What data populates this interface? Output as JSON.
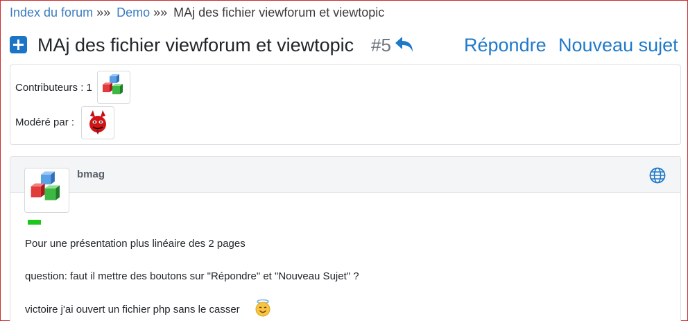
{
  "breadcrumb": {
    "items": [
      {
        "label": "Index du forum",
        "link": true
      },
      {
        "label": "Demo",
        "link": true
      },
      {
        "label": "MAj des fichier viewforum et viewtopic",
        "link": false
      }
    ],
    "separator": "»»"
  },
  "topic": {
    "title": "MAj des fichier viewforum et viewtopic",
    "number": "#5",
    "reply_label": "Répondre",
    "new_topic_label": "Nouveau sujet",
    "accent_color": "#1f79c9"
  },
  "info": {
    "contributors_label": "Contributeurs : 1",
    "moderated_label": "Modéré par :",
    "contributor_icon": "cubes-avatar",
    "moderator_icon": "devil-avatar"
  },
  "post": {
    "author": "bmag",
    "avatar_icon": "cubes-avatar",
    "status_color": "#1dc51d",
    "paragraphs": [
      "Pour une présentation plus linéaire des 2 pages",
      "question: faut il mettre des boutons sur \"Répondre\" et \"Nouveau Sujet\" ?",
      "victoire j'ai ouvert un fichier php sans le casser"
    ],
    "smiley_icon": "angel-smiley-icon"
  }
}
